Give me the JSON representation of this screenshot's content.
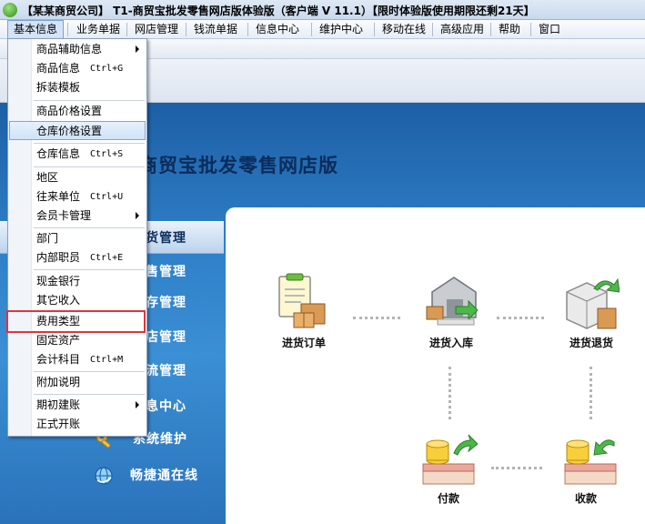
{
  "window": {
    "title": "【某某商贸公司】 T1-商贸宝批发零售网店版体验版（客户端 V 11.1）【限时体验版使用期限还剩21天】"
  },
  "menubar": {
    "items": [
      "基本信息",
      "业务单据",
      "网店管理",
      "钱流单据",
      "信息中心",
      "维护中心",
      "移动在线",
      "高级应用",
      "帮助",
      "窗口"
    ]
  },
  "banner": {
    "text": "商贸宝批发零售网店版"
  },
  "nav": {
    "items": [
      {
        "label": "货管理",
        "icon": "purchase-icon"
      },
      {
        "label": "售管理",
        "icon": "sales-icon"
      },
      {
        "label": "存管理",
        "icon": "inventory-icon"
      },
      {
        "label": "店管理",
        "icon": "shop-icon"
      },
      {
        "label": "流管理",
        "icon": "cashflow-icon"
      },
      {
        "label": "息中心",
        "icon": "info-icon"
      },
      {
        "label": "系统维护",
        "icon": "wrench-icon"
      },
      {
        "label": "畅捷通在线",
        "icon": "globe-icon"
      }
    ]
  },
  "flow": {
    "purchase_order": "进货订单",
    "purchase_in": "进货入库",
    "purchase_return": "进货退货",
    "payment": "付款",
    "receipt": "收款"
  },
  "dropdown": {
    "items": [
      {
        "label": "商品辅助信息",
        "shortcut": "",
        "submenu": true
      },
      {
        "label": "商品信息",
        "shortcut": "Ctrl+G",
        "submenu": false
      },
      {
        "label": "拆装模板",
        "shortcut": "",
        "submenu": false
      },
      {
        "label": "商品价格设置",
        "shortcut": "",
        "submenu": false
      },
      {
        "label": "仓库价格设置",
        "shortcut": "",
        "submenu": false
      },
      {
        "label": "仓库信息",
        "shortcut": "Ctrl+S",
        "submenu": false
      },
      {
        "label": "地区",
        "shortcut": "",
        "submenu": false
      },
      {
        "label": "往来单位",
        "shortcut": "Ctrl+U",
        "submenu": false
      },
      {
        "label": "会员卡管理",
        "shortcut": "",
        "submenu": true
      },
      {
        "label": "部门",
        "shortcut": "",
        "submenu": false
      },
      {
        "label": "内部职员",
        "shortcut": "Ctrl+E",
        "submenu": false
      },
      {
        "label": "现金银行",
        "shortcut": "",
        "submenu": false
      },
      {
        "label": "其它收入",
        "shortcut": "",
        "submenu": false
      },
      {
        "label": "费用类型",
        "shortcut": "",
        "submenu": false
      },
      {
        "label": "固定资产",
        "shortcut": "",
        "submenu": false
      },
      {
        "label": "会计科目",
        "shortcut": "Ctrl+M",
        "submenu": false
      },
      {
        "label": "附加说明",
        "shortcut": "",
        "submenu": false
      },
      {
        "label": "期初建账",
        "shortcut": "",
        "submenu": true
      },
      {
        "label": "正式开账",
        "shortcut": "",
        "submenu": false
      }
    ]
  },
  "colors": {
    "accent_blue": "#2f80c8",
    "highlight_red": "#e0343c"
  }
}
